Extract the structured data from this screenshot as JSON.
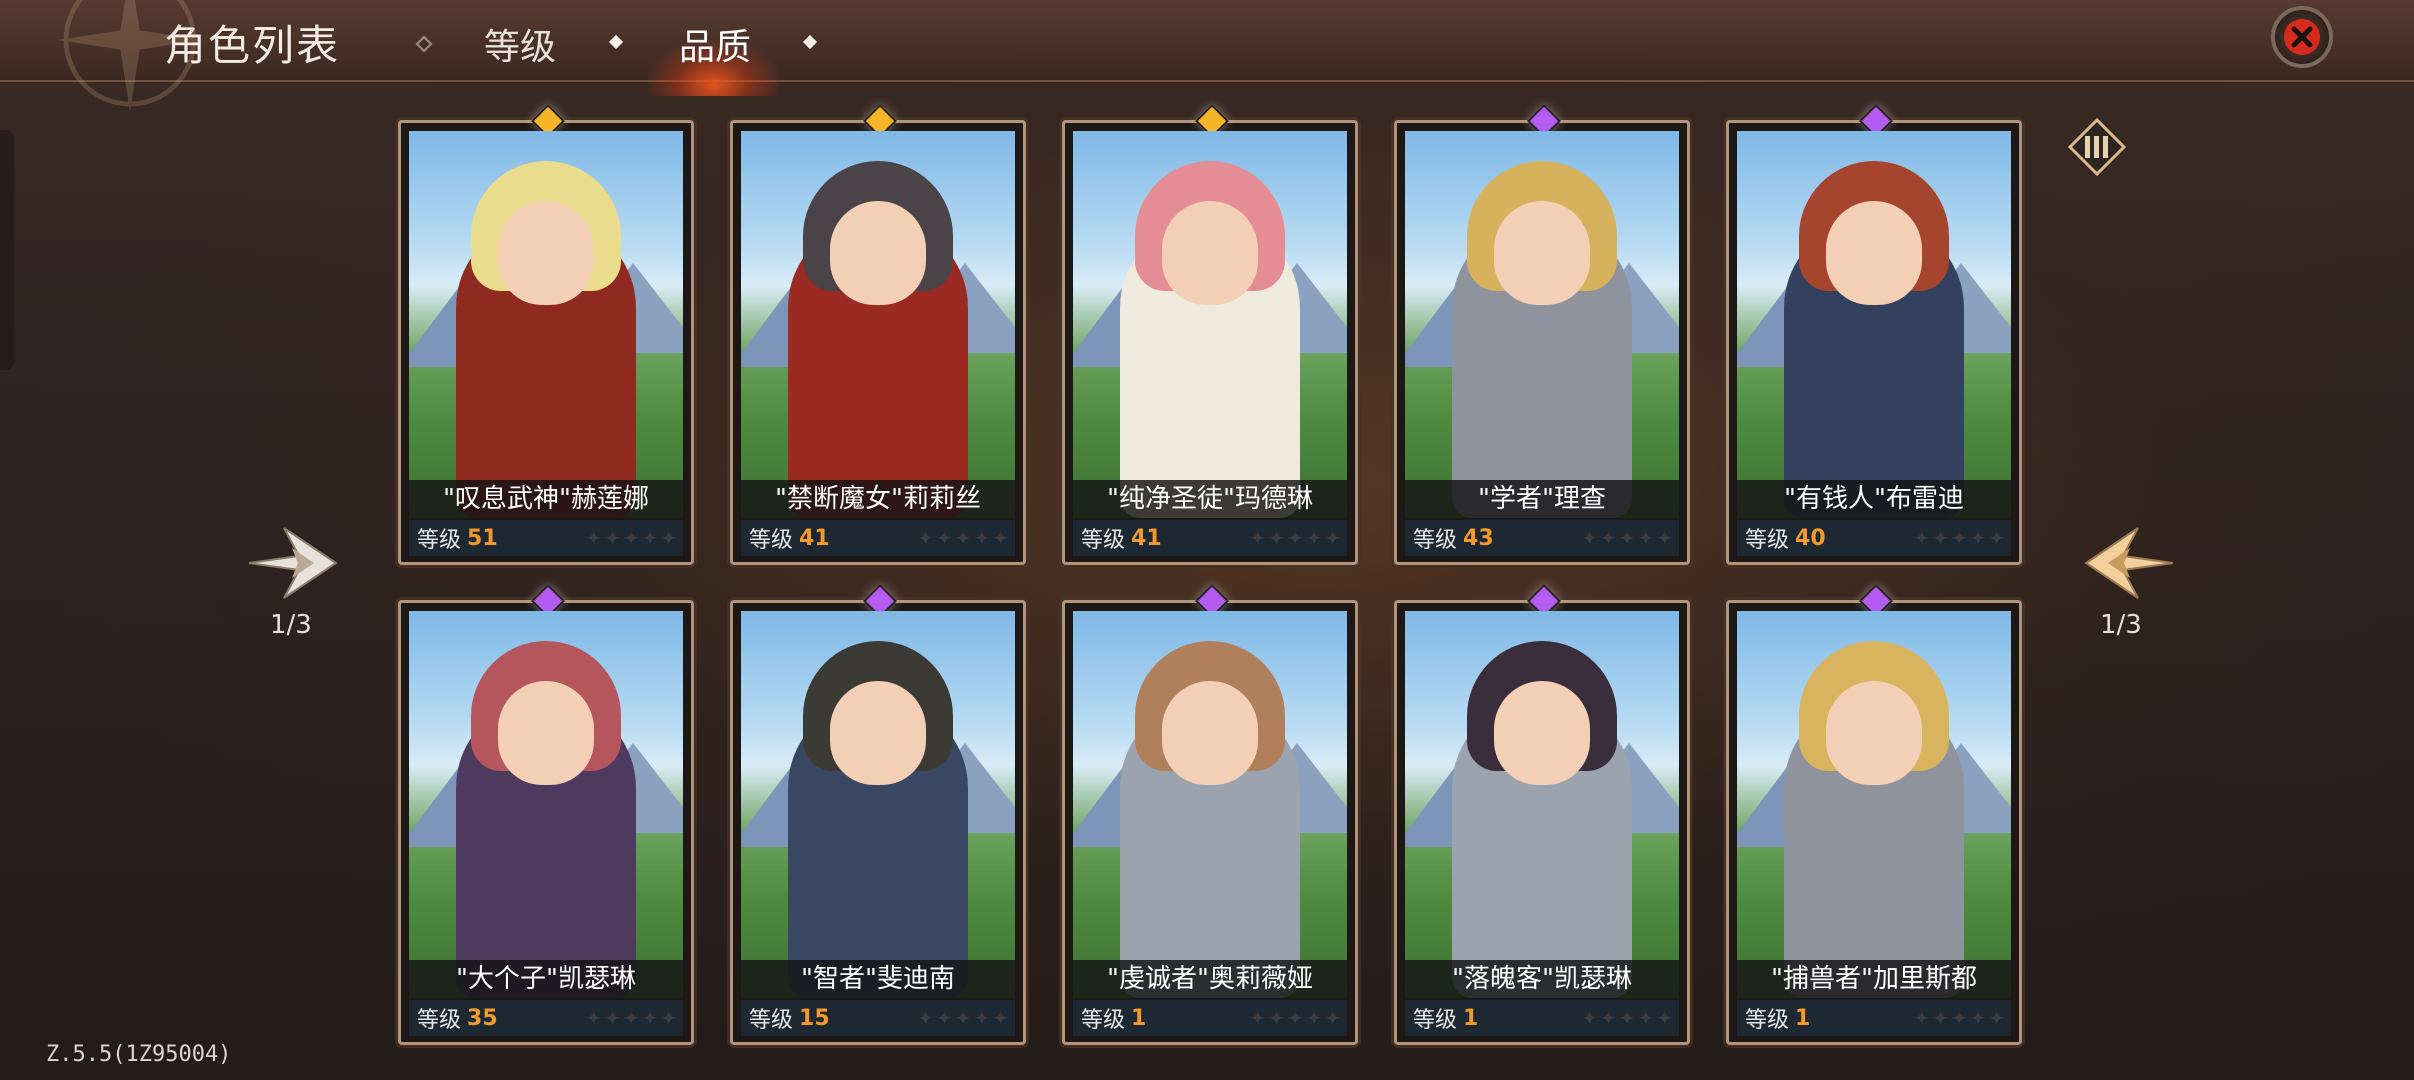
{
  "header": {
    "title": "角色列表",
    "tabs": [
      {
        "label": "等级",
        "active": false
      },
      {
        "label": "品质",
        "active": true
      }
    ]
  },
  "icons": {
    "close": "close-icon",
    "prev": "prev-page-arrow-icon",
    "next": "next-page-arrow-icon",
    "filter": "filter-columns-icon"
  },
  "colors": {
    "gold_rarity": "#f5b526",
    "purple_rarity": "#b45cf0",
    "level_value": "#f39a2a",
    "accent_close": "#e02a1a"
  },
  "level_label": "等级",
  "pagination": {
    "left": "1/3",
    "right": "1/3"
  },
  "characters": [
    {
      "name": "\"叹息武神\"赫莲娜",
      "level": "51",
      "rarity": "gold"
    },
    {
      "name": "\"禁断魔女\"莉莉丝",
      "level": "41",
      "rarity": "gold"
    },
    {
      "name": "\"纯净圣徒\"玛德琳",
      "level": "41",
      "rarity": "gold"
    },
    {
      "name": "\"学者\"理查",
      "level": "43",
      "rarity": "purple"
    },
    {
      "name": "\"有钱人\"布雷迪",
      "level": "40",
      "rarity": "purple"
    },
    {
      "name": "\"大个子\"凯瑟琳",
      "level": "35",
      "rarity": "purple"
    },
    {
      "name": "\"智者\"斐迪南",
      "level": "15",
      "rarity": "purple"
    },
    {
      "name": "\"虔诚者\"奥莉薇娅",
      "level": "1",
      "rarity": "purple"
    },
    {
      "name": "\"落魄客\"凯瑟琳",
      "level": "1",
      "rarity": "purple"
    },
    {
      "name": "\"捕兽者\"加里斯都",
      "level": "1",
      "rarity": "purple"
    }
  ],
  "version": "Z.5.5(1Z95004)"
}
